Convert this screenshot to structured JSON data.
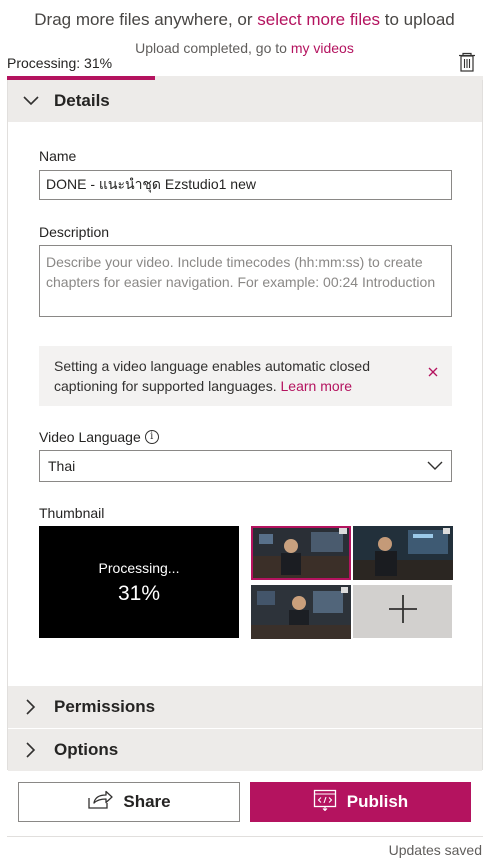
{
  "header": {
    "drag_text": "Drag more files anywhere, or ",
    "select_link": "select more files",
    "drag_suffix": " to upload",
    "upload_completed": "Upload completed, go to ",
    "my_videos_link": "my videos"
  },
  "progress": {
    "label": "Processing: 31%",
    "fraction": 0.31,
    "accent": "#b4135f"
  },
  "details": {
    "section_title": "Details",
    "name_label": "Name",
    "name_value": "DONE - แนะนำชุด Ezstudio1 new",
    "description_label": "Description",
    "description_placeholder": "Describe your video. Include timecodes (hh:mm:ss) to create chapters for easier navigation. For example: 00:24 Introduction",
    "notice_text": "Setting a video language enables automatic closed captioning for supported languages. ",
    "notice_link": "Learn more",
    "language_label": "Video Language",
    "language_value": "Thai",
    "thumbnail_label": "Thumbnail",
    "thumb_processing": "Processing...",
    "thumb_percent": "31%"
  },
  "sections": {
    "permissions": "Permissions",
    "options": "Options"
  },
  "actions": {
    "share": "Share",
    "publish": "Publish"
  },
  "status": {
    "updates_saved": "Updates saved"
  }
}
